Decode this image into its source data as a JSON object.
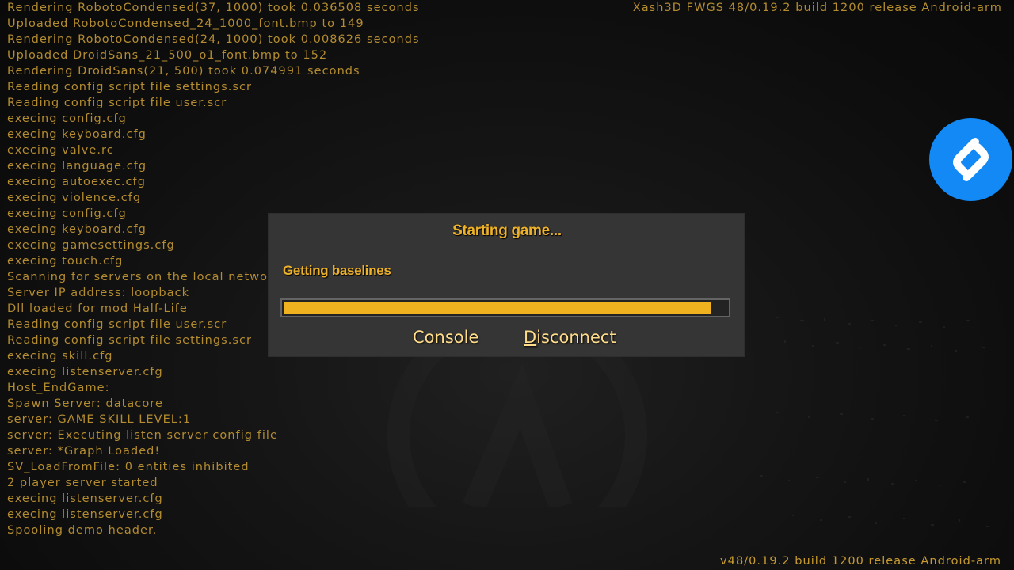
{
  "colors": {
    "console_text": "#b48c30",
    "accent": "#f0b21f",
    "button_text": "#ffdc8a",
    "dialog_bg": "#353535",
    "shazam_blue": "#1289f5"
  },
  "engine_title": "Xash3D FWGS 48/0.19.2 build 1200 release Android-arm",
  "version_footer": "v48/0.19.2 build 1200 release Android-arm",
  "console_lines": [
    "Rendering RobotoCondensed(37, 1000) took 0.036508 seconds",
    "Uploaded RobotoCondensed_24_1000_font.bmp to 149",
    "Rendering RobotoCondensed(24, 1000) took 0.008626 seconds",
    "Uploaded DroidSans_21_500_o1_font.bmp to 152",
    "Rendering DroidSans(21, 500) took 0.074991 seconds",
    "Reading config script file settings.scr",
    "Reading config script file user.scr",
    "execing config.cfg",
    "execing keyboard.cfg",
    "execing valve.rc",
    "execing language.cfg",
    "execing autoexec.cfg",
    "execing violence.cfg",
    "execing config.cfg",
    "execing keyboard.cfg",
    "execing gamesettings.cfg",
    "execing touch.cfg",
    "Scanning for servers on the local networ",
    "Server IP address: loopback",
    "Dll loaded for mod Half-Life",
    "Reading config script file user.scr",
    "Reading config script file settings.scr",
    "execing skill.cfg",
    "execing listenserver.cfg",
    "Host_EndGame:",
    "Spawn Server: datacore",
    "server: GAME SKILL LEVEL:1",
    "server: Executing listen server config file",
    "server: *Graph Loaded!",
    "SV_LoadFromFile: 0 entities inhibited",
    "2 player server started",
    "execing listenserver.cfg",
    "execing listenserver.cfg",
    "Spooling demo header."
  ],
  "dialog": {
    "title": "Starting game...",
    "status": "Getting baselines",
    "progress": 0.965,
    "buttons": {
      "console": "Console",
      "disconnect_hotkey": "D",
      "disconnect_rest": "isconnect"
    }
  },
  "icons": {
    "shazam": "shazam-icon",
    "background_logo": "lambda-logo-icon"
  }
}
